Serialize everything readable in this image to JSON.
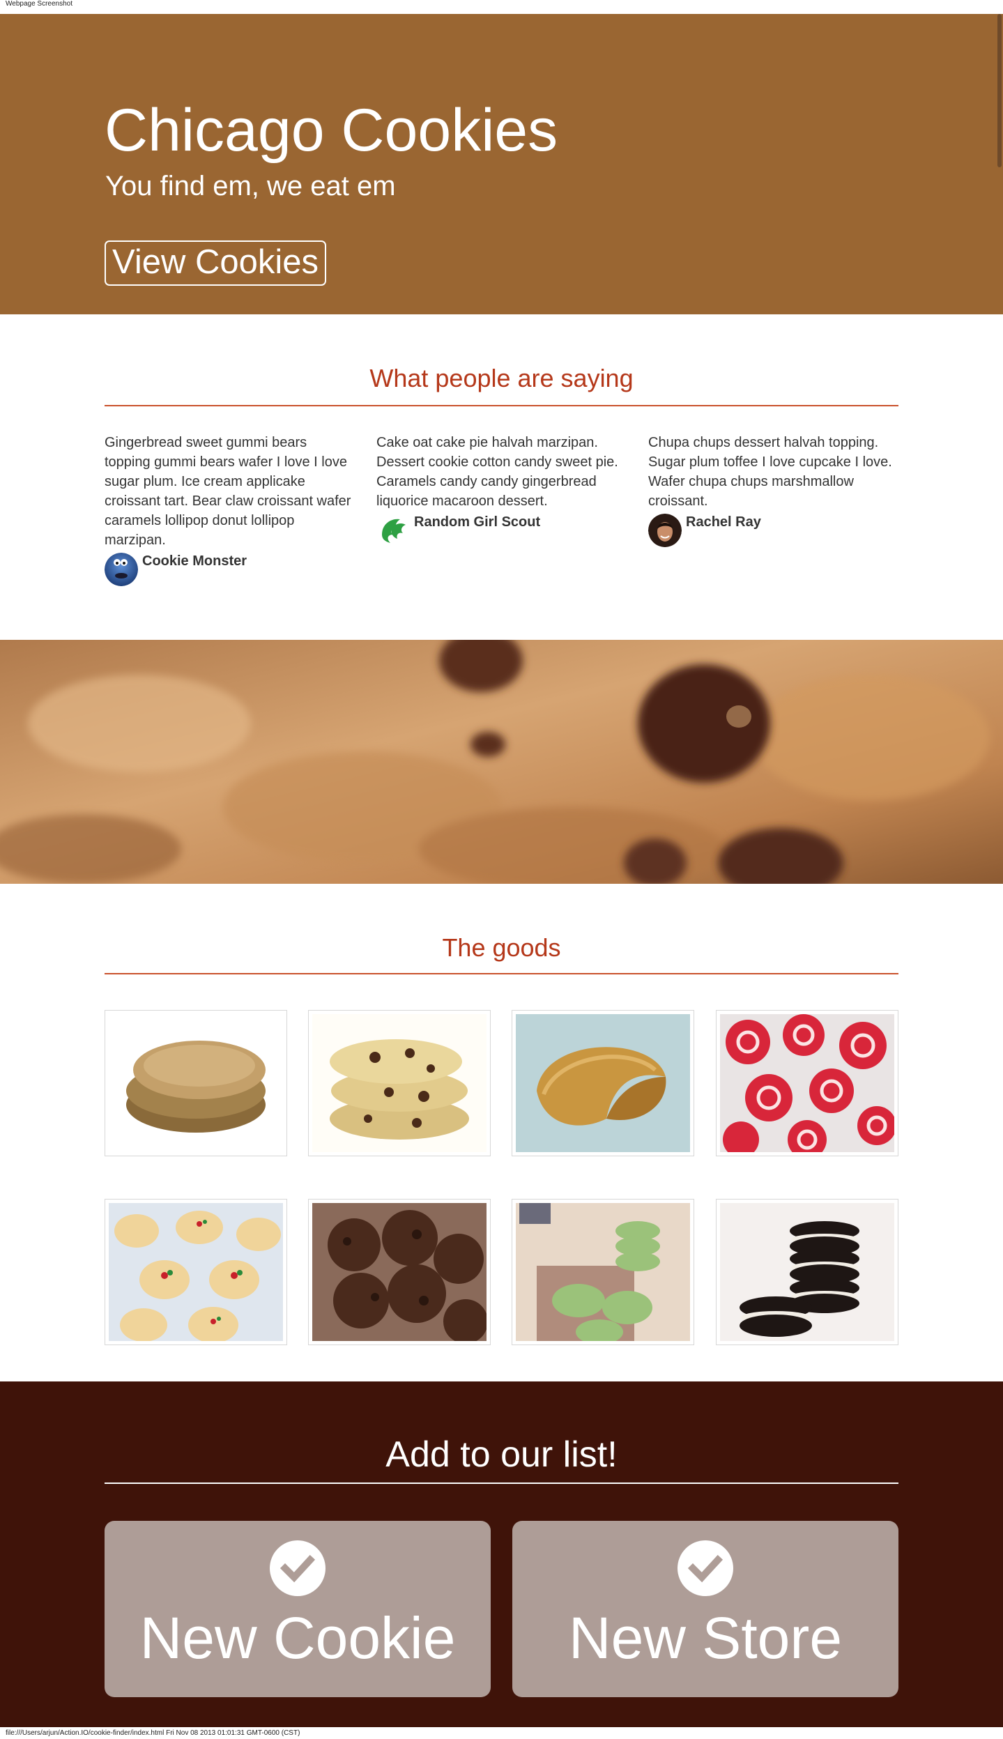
{
  "print_header": "Webpage Screenshot",
  "print_footer": "file:///Users/arjun/Action.IO/cookie-finder/index.html Fri Nov 08 2013 01:01:31 GMT-0600 (CST)",
  "hero": {
    "title": "Chicago Cookies",
    "subtitle": "You find em, we eat em",
    "button": "View Cookies"
  },
  "testimonials": {
    "title": "What people are saying",
    "items": [
      {
        "quote": "Gingerbread sweet gummi bears topping gummi bears wafer I love I love sugar plum. Ice cream applicake croissant tart. Bear claw croissant wafer caramels lollipop donut lollipop marzipan.",
        "author": "Cookie Monster",
        "avatar": "cookie-monster-avatar"
      },
      {
        "quote": "Cake oat cake pie halvah marzipan. Dessert cookie cotton candy sweet pie. Caramels candy candy gingerbread liquorice macaroon dessert.",
        "author": "Random Girl Scout",
        "avatar": "girl-scout-logo"
      },
      {
        "quote": "Chupa chups dessert halvah topping. Sugar plum toffee I love cupcake I love. Wafer chupa chups marshmallow croissant.",
        "author": "Rachel Ray",
        "avatar": "rachel-ray-avatar"
      }
    ]
  },
  "goods": {
    "title": "The goods",
    "items": [
      {
        "name": "ginger-snap-cookies-image"
      },
      {
        "name": "chocolate-chip-cookies-image"
      },
      {
        "name": "fortune-cookie-image"
      },
      {
        "name": "pinwheel-cookies-image"
      },
      {
        "name": "spritz-cookies-image"
      },
      {
        "name": "double-chocolate-cookies-image"
      },
      {
        "name": "matcha-cookies-image"
      },
      {
        "name": "oreo-cookies-image"
      }
    ]
  },
  "add": {
    "title": "Add to our list!",
    "new_cookie": "New Cookie",
    "new_store": "New Store"
  },
  "colors": {
    "hero_bg": "#9a6632",
    "accent": "#b5381a",
    "footer_bg": "#3f1309",
    "button_bg": "#ae9d97"
  }
}
